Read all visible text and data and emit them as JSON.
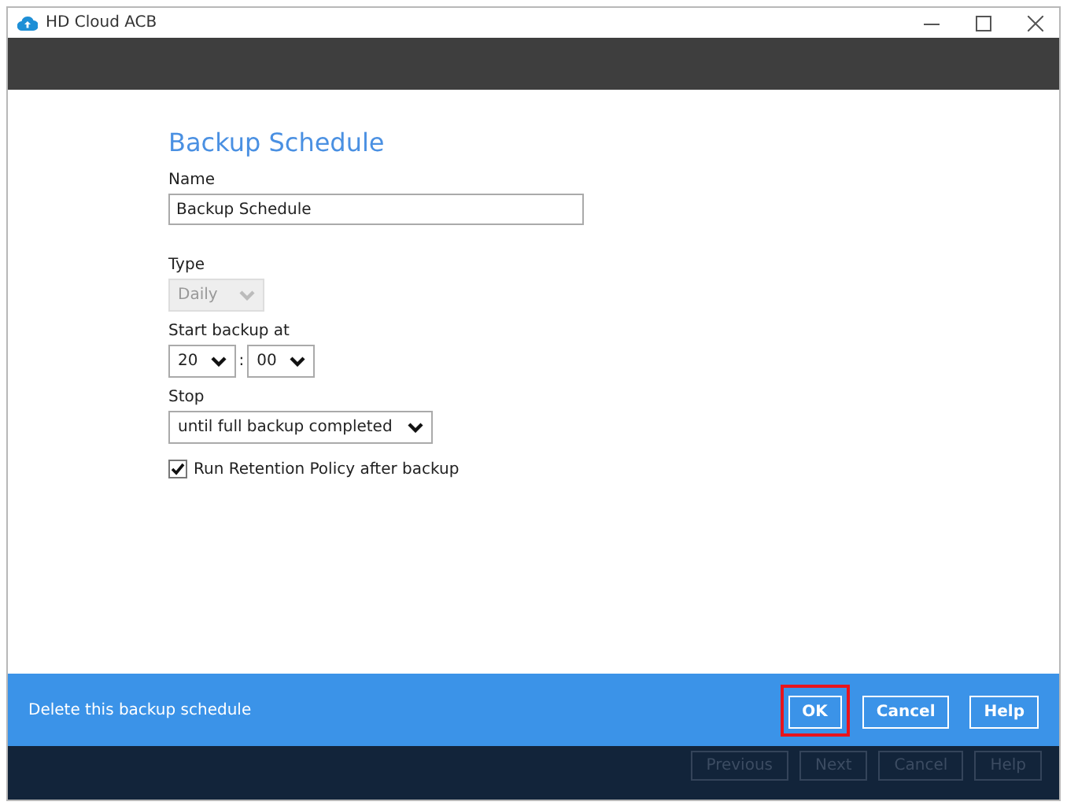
{
  "window": {
    "title": "HD Cloud ACB"
  },
  "form": {
    "heading": "Backup Schedule",
    "name": {
      "label": "Name",
      "value": "Backup Schedule"
    },
    "type": {
      "label": "Type",
      "value": "Daily",
      "disabled": true
    },
    "start": {
      "label": "Start backup at",
      "hour": "20",
      "separator": ":",
      "minute": "00"
    },
    "stop": {
      "label": "Stop",
      "value": "until full backup completed"
    },
    "retention": {
      "label": "Run Retention Policy after backup",
      "checked": true
    }
  },
  "action_bar": {
    "link": "Delete this backup schedule",
    "buttons": [
      {
        "label": "OK",
        "highlighted": true
      },
      {
        "label": "Cancel",
        "highlighted": false
      },
      {
        "label": "Help",
        "highlighted": false
      }
    ]
  },
  "nav_buttons": [
    {
      "label": "Previous",
      "disabled": true
    },
    {
      "label": "Next",
      "disabled": true
    },
    {
      "label": "Cancel",
      "disabled": true
    },
    {
      "label": "Help",
      "disabled": true
    }
  ]
}
